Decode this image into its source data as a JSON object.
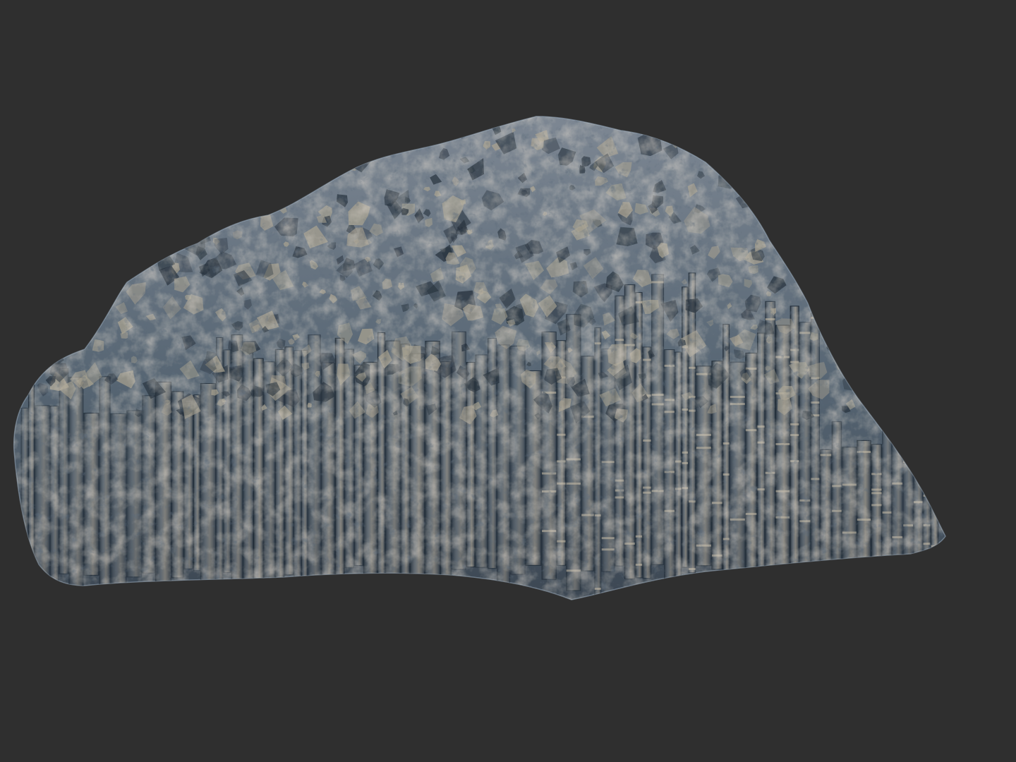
{
  "viewport": {
    "background": "#2f2f2f",
    "subject": "basalt-column-rock-sculpt"
  },
  "colors": {
    "rock_base": "#566573",
    "rock_light": "#b7ab98",
    "rock_mid": "#7d8793",
    "rock_shadow": "#1f2a35",
    "rock_edge": "#9fb4c8"
  }
}
